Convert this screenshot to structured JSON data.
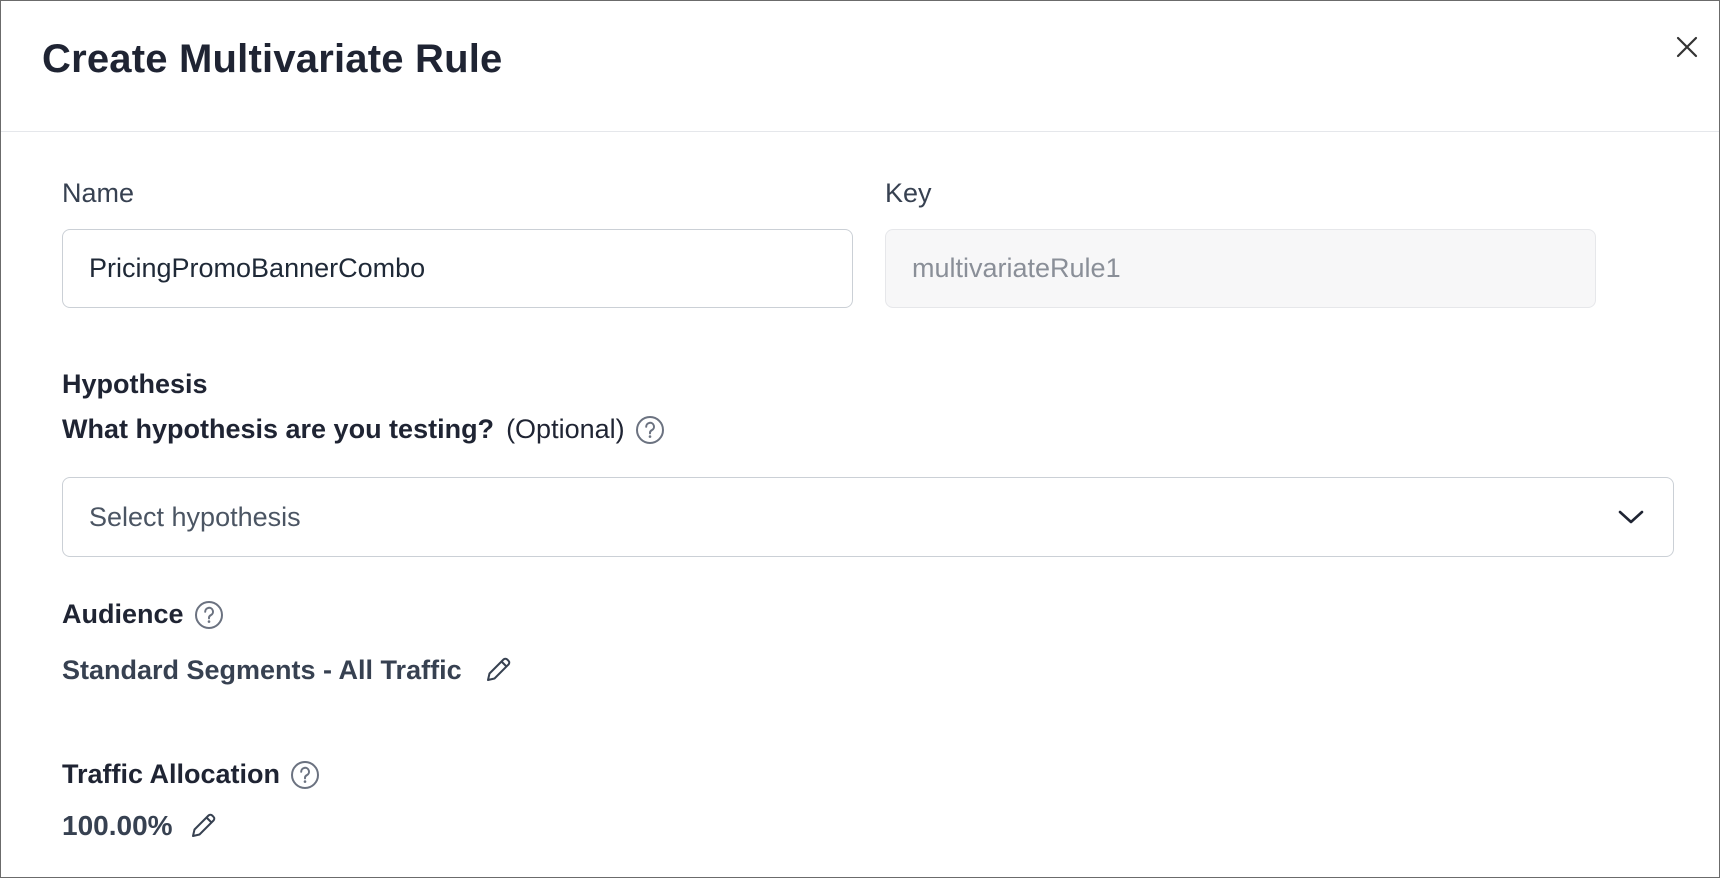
{
  "modal": {
    "title": "Create Multivariate Rule"
  },
  "name_field": {
    "label": "Name",
    "value": "PricingPromoBannerCombo"
  },
  "key_field": {
    "label": "Key",
    "value": "multivariateRule1"
  },
  "hypothesis": {
    "heading": "Hypothesis",
    "question": "What hypothesis are you testing?",
    "optional": "(Optional)",
    "select_placeholder": "Select hypothesis"
  },
  "audience": {
    "heading": "Audience",
    "value": "Standard Segments - All Traffic"
  },
  "traffic": {
    "heading": "Traffic Allocation",
    "value": "100.00%"
  },
  "icons": {
    "close": "close-icon",
    "help": "help-circle-icon",
    "chevron": "chevron-down-icon",
    "edit": "pencil-icon"
  }
}
